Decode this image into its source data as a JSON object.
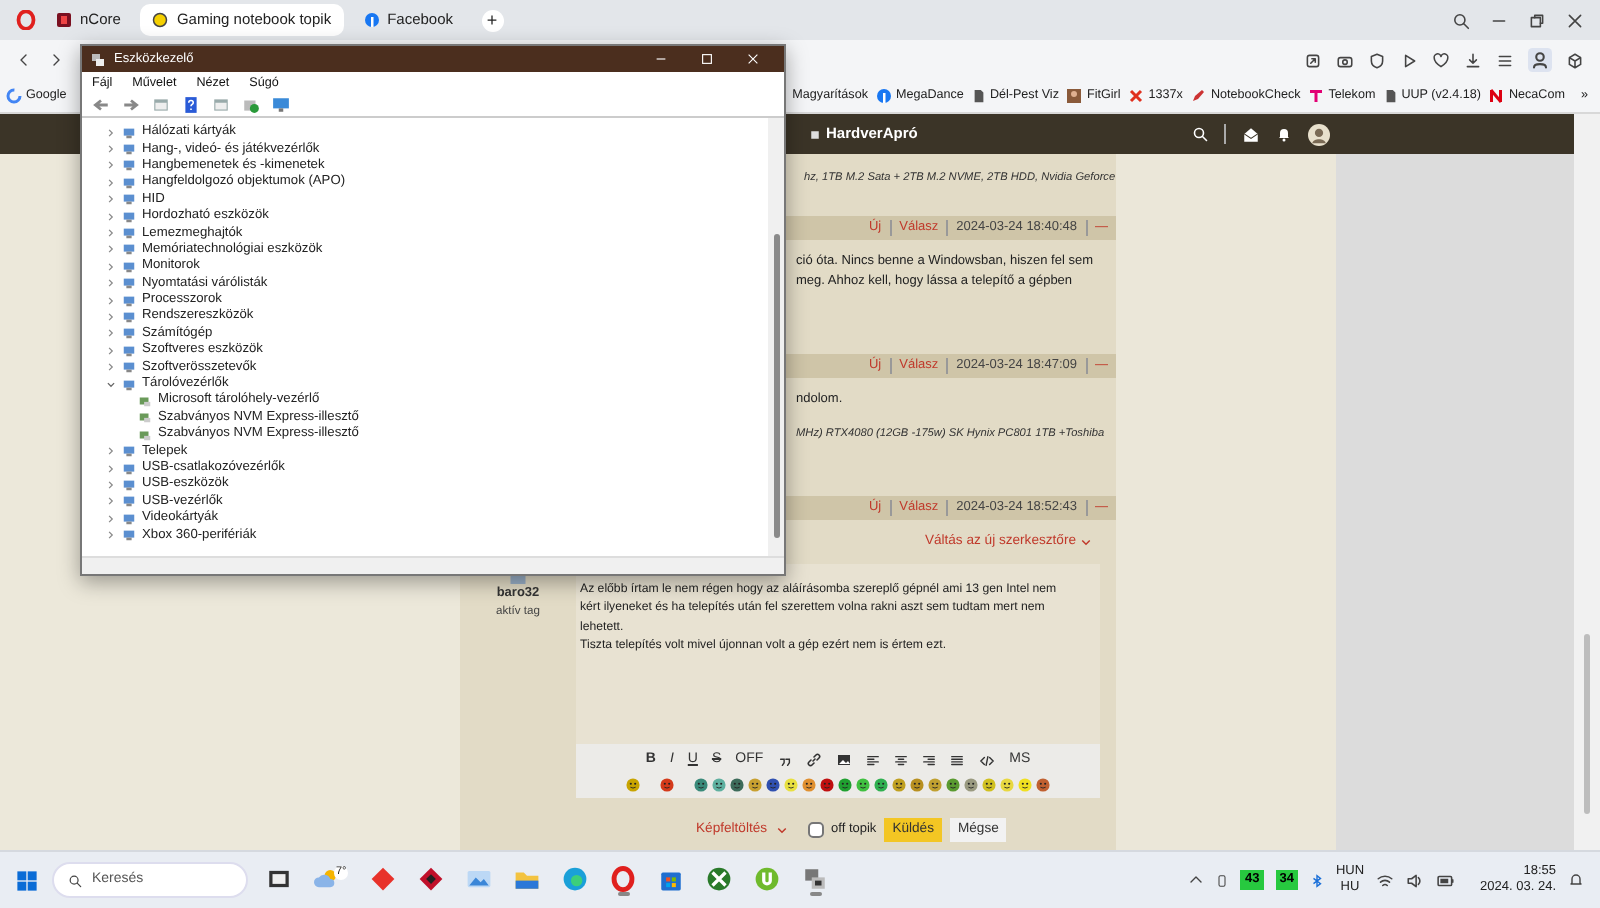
{
  "browser": {
    "tabs": [
      {
        "label": "nCore",
        "selected": false,
        "kind": "square"
      },
      {
        "label": "Gaming notebook topik",
        "selected": true,
        "kind": "ring"
      },
      {
        "label": "Facebook",
        "selected": false,
        "kind": "disc"
      }
    ],
    "new_tab": "+",
    "bookmarks": [
      {
        "label": "Google",
        "kind": "g"
      },
      {
        "label": "Magyarítások",
        "kind": "plain"
      },
      {
        "label": "MegaDance",
        "kind": "disc"
      },
      {
        "label": "Dél-Pest Viz",
        "kind": "page"
      },
      {
        "label": "FitGirl",
        "kind": "photo"
      },
      {
        "label": "1337x",
        "kind": "cross"
      },
      {
        "label": "NotebookCheck",
        "kind": "pen"
      },
      {
        "label": "Telekom",
        "kind": "tee"
      },
      {
        "label": "UUP (v2.4.18)",
        "kind": "page"
      },
      {
        "label": "NecaCom",
        "kind": "bar"
      }
    ],
    "bookmarks_more": "»"
  },
  "site": {
    "brand": "HardverApró",
    "top_signature": "hz, 1TB M.2 Sata + 2TB M.2 NVME, 2TB HDD, Nvidia Geforce",
    "posts": [
      {
        "new": "Új",
        "reply": "Válasz",
        "timestamp": "2024-03-24 18:40:48",
        "collapse": "—",
        "body": [
          "ció óta. Nincs benne a Windowsban, hiszen fel sem",
          "meg. Ahhoz kell, hogy lássa a telepítő a gépben"
        ]
      },
      {
        "new": "Új",
        "reply": "Válasz",
        "timestamp": "2024-03-24 18:47:09",
        "collapse": "—",
        "body": [
          "ndolom."
        ],
        "signature": "MHz) RTX4080 (12GB -175w) SK Hynix PC801 1TB +Toshiba"
      },
      {
        "new": "Új",
        "reply": "Válasz",
        "timestamp": "2024-03-24 18:52:43",
        "collapse": "—"
      }
    ],
    "editor": {
      "switch_link": "Váltás az új szerkesztőre",
      "user": {
        "name": "baro32",
        "rank": "aktív tag"
      },
      "text": [
        "Az előbb írtam le nem régen hogy az aláírásomba szereplő gépnél ami 13 gen Intel nem",
        "kért ilyeneket és ha telepítés után fel szerettem volna rakni aszt sem tudtam mert nem",
        "lehetett.",
        "Tiszta telepítés volt mivel újonnan volt a gép ezért nem is értem ezt."
      ],
      "format_buttons": [
        {
          "kind": "bold",
          "label": "B"
        },
        {
          "kind": "italic",
          "label": "I"
        },
        {
          "kind": "underline",
          "label": "U"
        },
        {
          "kind": "strike",
          "label": "S"
        },
        {
          "kind": "text",
          "label": "OFF"
        },
        {
          "kind": "quote"
        },
        {
          "kind": "link"
        },
        {
          "kind": "image"
        },
        {
          "kind": "align-left"
        },
        {
          "kind": "align-center"
        },
        {
          "kind": "align-right"
        },
        {
          "kind": "justify"
        },
        {
          "kind": "code"
        },
        {
          "kind": "text",
          "label": "MS"
        }
      ],
      "smileys": [
        {
          "color": "#c8a400"
        },
        {
          "color": "#d43a1a"
        },
        {
          "color": "#3a8a7a"
        },
        {
          "color": "#5fb0a0"
        },
        {
          "color": "#3d6b5a"
        },
        {
          "color": "#c8a030"
        },
        {
          "color": "#3050b0"
        },
        {
          "color": "#e8e040"
        },
        {
          "color": "#e09030"
        },
        {
          "color": "#c01010"
        },
        {
          "color": "#20a030"
        },
        {
          "color": "#40c040"
        },
        {
          "color": "#30b050"
        },
        {
          "color": "#c0a020"
        },
        {
          "color": "#b89020"
        },
        {
          "color": "#c0a030"
        },
        {
          "color": "#5a9a30"
        },
        {
          "color": "#9a9a80"
        },
        {
          "color": "#d0c020"
        },
        {
          "color": "#e8d840"
        },
        {
          "color": "#f0e020"
        },
        {
          "color": "#c06030"
        }
      ],
      "upload": "Képfeltöltés",
      "off_topic": {
        "label": "off topik",
        "checked": false
      },
      "submit": "Küldés",
      "cancel": "Mégse"
    }
  },
  "device_manager": {
    "title": "Eszközkezelő",
    "menu": [
      "Fájl",
      "Művelet",
      "Nézet",
      "Súgó"
    ],
    "tree": [
      {
        "label": "Hálózati kártyák",
        "expanded": false
      },
      {
        "label": "Hang-, videó- és játékvezérlők",
        "expanded": false
      },
      {
        "label": "Hangbemenetek és -kimenetek",
        "expanded": false
      },
      {
        "label": "Hangfeldolgozó objektumok (APO)",
        "expanded": false
      },
      {
        "label": "HID",
        "expanded": false
      },
      {
        "label": "Hordozható eszközök",
        "expanded": false
      },
      {
        "label": "Lemezmeghajtók",
        "expanded": false
      },
      {
        "label": "Memóriatechnológiai eszközök",
        "expanded": false
      },
      {
        "label": "Monitorok",
        "expanded": false
      },
      {
        "label": "Nyomtatási várólisták",
        "expanded": false
      },
      {
        "label": "Processzorok",
        "expanded": false
      },
      {
        "label": "Rendszereszközök",
        "expanded": false
      },
      {
        "label": "Számítógép",
        "expanded": false
      },
      {
        "label": "Szoftveres eszközök",
        "expanded": false
      },
      {
        "label": "Szoftverösszetevők",
        "expanded": false
      },
      {
        "label": "Tárolóvezérlők",
        "expanded": true,
        "children": [
          {
            "label": "Microsoft tárolóhely-vezérlő"
          },
          {
            "label": "Szabványos NVM Express-illesztő"
          },
          {
            "label": "Szabványos NVM Express-illesztő"
          }
        ]
      },
      {
        "label": "Telepek",
        "expanded": false
      },
      {
        "label": "USB-csatlakozóvezérlők",
        "expanded": false
      },
      {
        "label": "USB-eszközök",
        "expanded": false
      },
      {
        "label": "USB-vezérlők",
        "expanded": false
      },
      {
        "label": "Videokártyák",
        "expanded": false
      },
      {
        "label": "Xbox 360-perifériák",
        "expanded": false
      }
    ]
  },
  "taskbar": {
    "search_placeholder": "Keresés",
    "apps": [
      {
        "kind": "taskview",
        "running": false
      },
      {
        "kind": "weather",
        "label": "7°",
        "running": false
      },
      {
        "kind": "diamond",
        "running": false
      },
      {
        "kind": "diamond-dark",
        "running": false
      },
      {
        "kind": "photos",
        "running": false
      },
      {
        "kind": "folder",
        "running": false
      },
      {
        "kind": "edge",
        "running": false
      },
      {
        "kind": "opera",
        "running": true
      },
      {
        "kind": "store",
        "running": false
      },
      {
        "kind": "xbox",
        "running": false
      },
      {
        "kind": "torrent",
        "running": false
      },
      {
        "kind": "devmgr",
        "running": true
      }
    ],
    "badges": [
      "43",
      "34"
    ],
    "language": "HUN",
    "layout": "HU",
    "time": "18:55",
    "date": "2024. 03. 24."
  }
}
